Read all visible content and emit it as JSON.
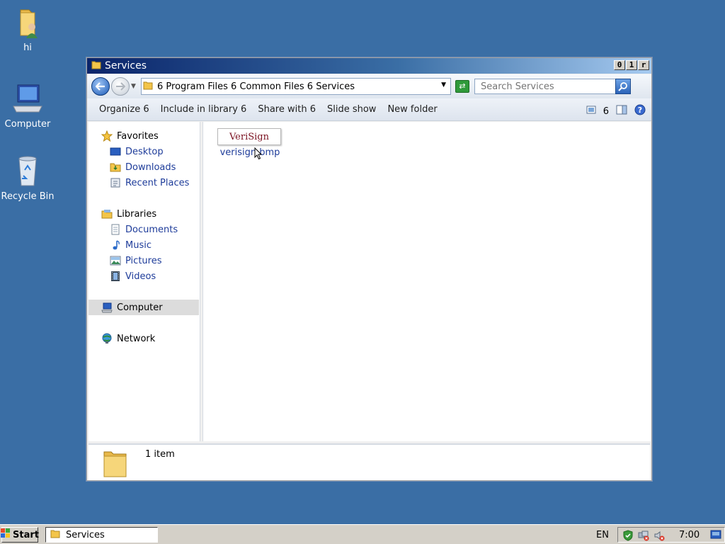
{
  "desktop": {
    "icons": [
      {
        "label": "hi",
        "icon": "user-folder-icon"
      },
      {
        "label": "Computer",
        "icon": "computer-icon"
      },
      {
        "label": "Recycle Bin",
        "icon": "recycle-bin-icon"
      }
    ]
  },
  "window": {
    "title": "Services",
    "controls": {
      "minimize": "0",
      "maximize": "1",
      "close": "r"
    },
    "address": {
      "breadcrumb": "6  Program Files 6  Common Files 6  Services"
    },
    "search": {
      "placeholder": "Search Services"
    },
    "toolbar": {
      "organize": "Organize 6",
      "include_in_library": "Include in library 6",
      "share_with": "Share with 6",
      "slide_show": "Slide show",
      "new_folder": "New folder",
      "views_arrow": "6"
    },
    "nav": {
      "favorites": "Favorites",
      "desktop": "Desktop",
      "downloads": "Downloads",
      "recent_places": "Recent Places",
      "libraries": "Libraries",
      "documents": "Documents",
      "music": "Music",
      "pictures": "Pictures",
      "videos": "Videos",
      "computer": "Computer",
      "network": "Network"
    },
    "files": [
      {
        "name": "verisign.bmp",
        "thumb_text": "VeriSign"
      }
    ],
    "details": {
      "item_count": "1 item"
    }
  },
  "taskbar": {
    "start_label": "Start",
    "task": "Services",
    "language": "EN",
    "clock": "7:00"
  }
}
